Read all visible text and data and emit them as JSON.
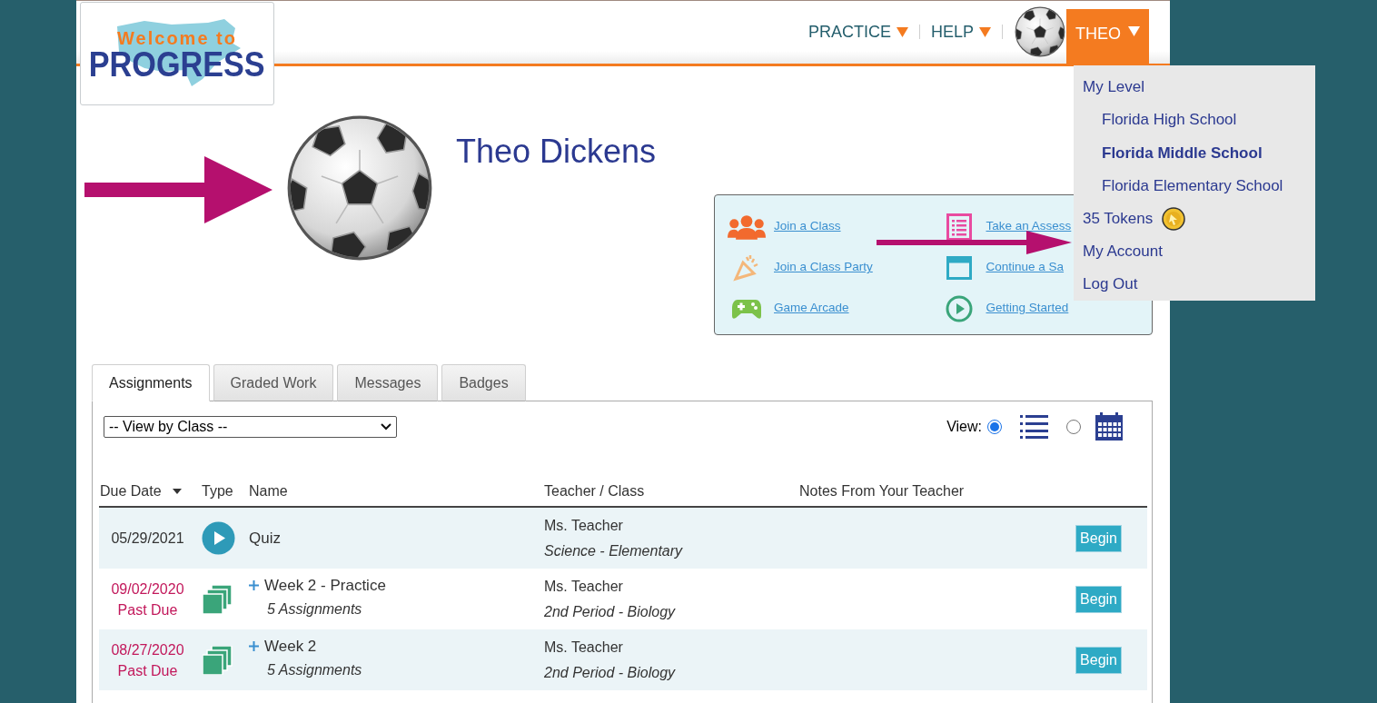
{
  "logo": {
    "line_1": "Welcome to",
    "line_2": "PROGRESS"
  },
  "nav": [
    {
      "label": "PRACTICE"
    },
    {
      "label": "HELP"
    }
  ],
  "user_menu": {
    "label": "THEO",
    "expanded": true,
    "items": [
      {
        "kind": "heading",
        "label": "My Level"
      },
      {
        "kind": "level",
        "label": "Florida High School",
        "selected": false
      },
      {
        "kind": "level",
        "label": "Florida Middle School",
        "selected": true
      },
      {
        "kind": "level",
        "label": "Florida Elementary School",
        "selected": false
      },
      {
        "kind": "tokens",
        "label": "35 Tokens"
      },
      {
        "kind": "link",
        "label": "My Account"
      },
      {
        "kind": "link",
        "label": "Log Out"
      }
    ]
  },
  "profile": {
    "name": "Theo Dickens"
  },
  "quick_links": [
    {
      "label": "Join a Class"
    },
    {
      "label": "Take an Assess"
    },
    {
      "label": "Join a Class Party"
    },
    {
      "label": "Continue a Sa"
    },
    {
      "label": "Game Arcade"
    },
    {
      "label": "Getting Started"
    }
  ],
  "tabs": [
    {
      "label": "Assignments",
      "selected": true
    },
    {
      "label": "Graded Work",
      "selected": false
    },
    {
      "label": "Messages",
      "selected": false
    },
    {
      "label": "Badges",
      "selected": false
    }
  ],
  "filter": {
    "value": "-- View by Class --"
  },
  "view": {
    "label": "View:",
    "options": [
      {
        "kind": "list",
        "selected": true
      },
      {
        "kind": "calendar",
        "selected": false
      }
    ]
  },
  "table": {
    "columns": [
      {
        "label": "Due Date",
        "sorted": true
      },
      {
        "label": "Type",
        "sorted": false
      },
      {
        "label": "Name",
        "sorted": false
      },
      {
        "label": "Teacher / Class",
        "sorted": false
      },
      {
        "label": "Notes From Your Teacher",
        "sorted": false
      }
    ],
    "rows": [
      {
        "due": "05/29/2021",
        "past_due": false,
        "kind": "quiz",
        "name": "Quiz",
        "expandable": false,
        "teacher": "Ms. Teacher",
        "class": "Science - Elementary",
        "action": "Begin"
      },
      {
        "due": "09/02/2020",
        "past_due": true,
        "status": "Past Due",
        "kind": "set",
        "name": "Week 2 - Practice",
        "expandable": true,
        "count": "5 Assignments",
        "teacher": "Ms. Teacher",
        "class": "2nd Period - Biology",
        "action": "Begin"
      },
      {
        "due": "08/27/2020",
        "past_due": true,
        "status": "Past Due",
        "kind": "set",
        "name": "Week 2",
        "expandable": true,
        "count": "5 Assignments",
        "teacher": "Ms. Teacher",
        "class": "2nd Period - Biology",
        "action": "Begin"
      }
    ]
  }
}
